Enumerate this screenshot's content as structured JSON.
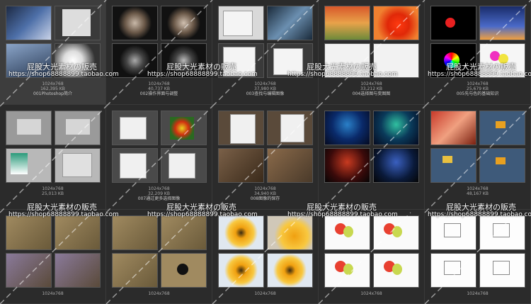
{
  "cells": [
    {
      "size": "1024x768",
      "filesize": "162,395 KB",
      "name": "001Photoshop简介"
    },
    {
      "size": "1024x768",
      "filesize": "40,737 KB",
      "name": "002操作界面与调整"
    },
    {
      "size": "1024x768",
      "filesize": "37,980 KB",
      "name": "003查找与编辑图像"
    },
    {
      "size": "1024x768",
      "filesize": "33,212 KB",
      "name": "004选择图与变图图"
    },
    {
      "size": "1024x768",
      "filesize": "25,679 KB",
      "name": "005先与色的基础知识"
    },
    {
      "size": "1024x768",
      "filesize": "25,013 KB",
      "name": ""
    },
    {
      "size": "1024x768",
      "filesize": "32,209 KB",
      "name": "007通过更多选择图像"
    },
    {
      "size": "1024x768",
      "filesize": "34,940 KB",
      "name": "008图像的保存"
    },
    {
      "size": "",
      "filesize": "",
      "name": ""
    },
    {
      "size": "1024x768",
      "filesize": "48,167 KB",
      "name": ""
    },
    {
      "size": "1024x768",
      "filesize": "",
      "name": ""
    },
    {
      "size": "1024x768",
      "filesize": "",
      "name": ""
    },
    {
      "size": "1024x768",
      "filesize": "",
      "name": ""
    },
    {
      "size": "1024x768",
      "filesize": "",
      "name": ""
    },
    {
      "size": "1024x768",
      "filesize": "",
      "name": ""
    }
  ],
  "watermark": {
    "cn": "屁股大光素材の販売",
    "url": "https://shop68888899.taobao.com"
  }
}
